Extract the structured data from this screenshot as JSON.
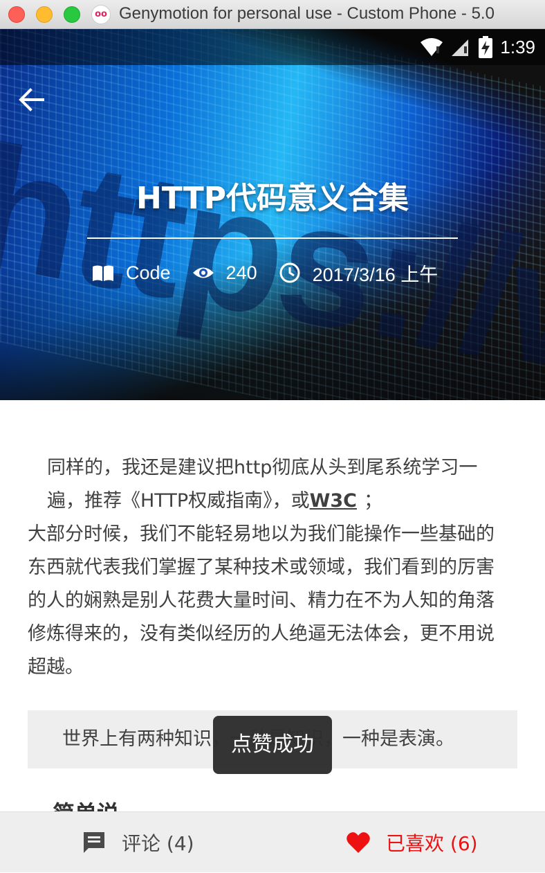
{
  "window": {
    "title": "Genymotion for personal use - Custom Phone - 5.0"
  },
  "statusbar": {
    "time": "1:39"
  },
  "header": {
    "title": "HTTP代码意义合集",
    "category": "Code",
    "views": "240",
    "date": "2017/3/16 上午"
  },
  "article": {
    "para1_lead": "同样的，我还是建议把http彻底从头到尾系统学习一遍，推荐《HTTP权威指南》，或",
    "link_label": "W3C",
    "para1_tail": "；",
    "para2": "大部分时候，我们不能轻易地以为我们能操作一些基础的东西就代表我们掌握了某种技术或领域，我们看到的厉害的人的娴熟是别人花费大量时间、精力在不为人知的角落修炼得来的，没有类似经历的人绝逼无法体会，更不用说超越。",
    "quote": "世界上有两种知识，一种是知识，一种是表演。",
    "next_heading_partial": "简单说"
  },
  "toast": {
    "message": "点赞成功"
  },
  "bottombar": {
    "comment_label": "评论 (4)",
    "like_label": "已喜欢 (6)"
  },
  "colors": {
    "like_accent": "#ee1111",
    "quote_bg": "#eeeeee",
    "toast_bg": "#2f2f2f"
  },
  "icons": {
    "back": "arrow-left-icon",
    "category": "book-open-icon",
    "views": "eye-icon",
    "date": "clock-icon",
    "comment": "comment-icon",
    "like": "heart-icon"
  }
}
